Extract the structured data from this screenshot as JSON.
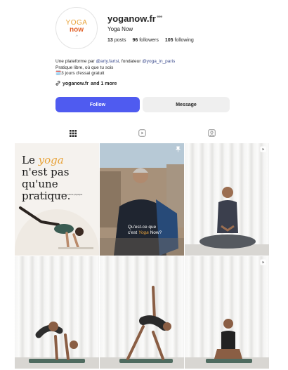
{
  "profile": {
    "username": "yoganow.fr",
    "more_label": "•••",
    "display_name": "Yoga Now",
    "avatar": {
      "logo_top": "YOGA",
      "logo_bottom": "now",
      "logo_suffix": ".fr"
    },
    "stats": {
      "posts_count": "13",
      "posts_label": "posts",
      "followers_count": "96",
      "followers_label": "followers",
      "following_count": "105",
      "following_label": "following"
    },
    "bio": {
      "line1_prefix": "Une plateforme par ",
      "mention1": "@arty.fartsi",
      "line1_mid": ", fondateur ",
      "mention2": "@yoga_in_paris",
      "line2": "Pratique libre, où que tu sois",
      "line3_emoji": "🗓️",
      "line3": "3 jours d'essai gratuit"
    },
    "link": {
      "url": "yoganow.fr",
      "more": "and 1 more"
    },
    "buttons": {
      "follow": "Follow",
      "message": "Message"
    }
  },
  "tabs": [
    {
      "name": "posts",
      "icon": "grid-icon",
      "active": true
    },
    {
      "name": "reels",
      "icon": "reels-icon",
      "active": false
    },
    {
      "name": "tagged",
      "icon": "tagged-icon",
      "active": false
    }
  ],
  "posts": [
    {
      "type": "image",
      "title_parts": [
        "Le ",
        "yoga",
        " n'est pas qu'une pratique."
      ],
      "subtitle": "La pratique du yoga n'est pas qu'une posture physique"
    },
    {
      "type": "image",
      "pinned": true,
      "caption_parts": [
        "Qu'est-ce que",
        "c'est ",
        "Yoga",
        " Now?"
      ]
    },
    {
      "type": "reel"
    },
    {
      "type": "image"
    },
    {
      "type": "image"
    },
    {
      "type": "reel"
    }
  ],
  "colors": {
    "accent_blue": "#4f5bf0",
    "logo_orange": "#e2622a",
    "logo_yellow": "#e8a33a",
    "mention_blue": "#3a4a8c"
  }
}
